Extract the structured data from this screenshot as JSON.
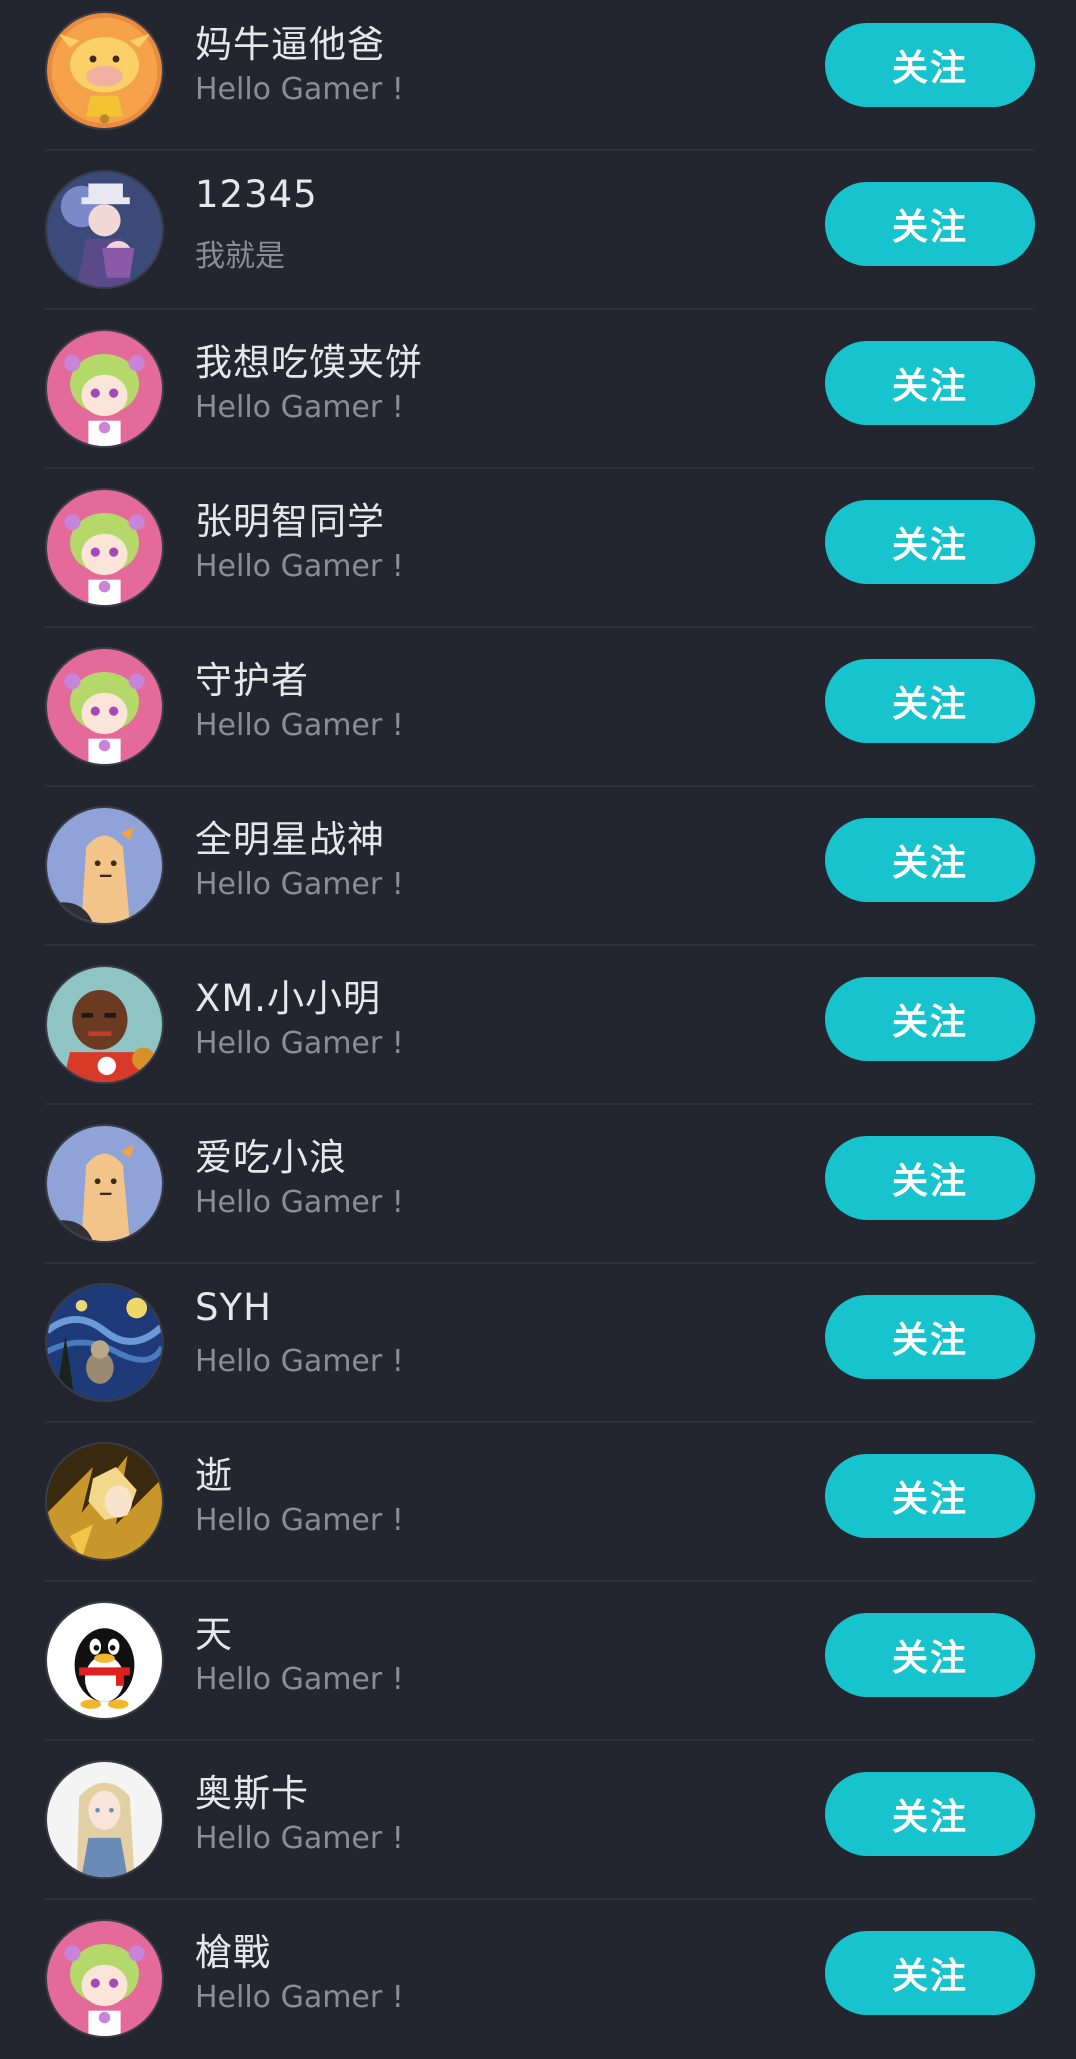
{
  "follow_label": "关注",
  "users": [
    {
      "name": "妈牛逼他爸",
      "bio": "Hello Gamer !",
      "avatar": "cow-bell-avatar-icon"
    },
    {
      "name": "12345",
      "bio": "我就是",
      "avatar": "anime-detective-avatar-icon"
    },
    {
      "name": "我想吃馍夹饼",
      "bio": "Hello Gamer !",
      "avatar": "green-hair-girl-avatar-icon"
    },
    {
      "name": "张明智同学",
      "bio": "Hello Gamer !",
      "avatar": "green-hair-girl-avatar-icon"
    },
    {
      "name": "守护者",
      "bio": "Hello Gamer !",
      "avatar": "green-hair-girl-avatar-icon"
    },
    {
      "name": "全明星战神",
      "bio": "Hello Gamer !",
      "avatar": "potato-avatar-icon"
    },
    {
      "name": "XM.小小明",
      "bio": "Hello Gamer !",
      "avatar": "basketball-player-avatar-icon"
    },
    {
      "name": "爱吃小浪",
      "bio": "Hello Gamer !",
      "avatar": "potato-avatar-icon"
    },
    {
      "name": "SYH",
      "bio": "Hello Gamer !",
      "avatar": "starry-night-avatar-icon"
    },
    {
      "name": "逝",
      "bio": "Hello Gamer !",
      "avatar": "golden-warrior-avatar-icon"
    },
    {
      "name": "天",
      "bio": "Hello Gamer !",
      "avatar": "penguin-avatar-icon"
    },
    {
      "name": "奥斯卡",
      "bio": "Hello Gamer !",
      "avatar": "blonde-woman-avatar-icon"
    },
    {
      "name": "槍戰",
      "bio": "Hello Gamer !",
      "avatar": "green-hair-girl-avatar-icon"
    }
  ],
  "colors": {
    "background": "#23252f",
    "accent": "#17c3cc",
    "name_text": "#e6e7ea",
    "bio_text": "#8a8d97"
  }
}
